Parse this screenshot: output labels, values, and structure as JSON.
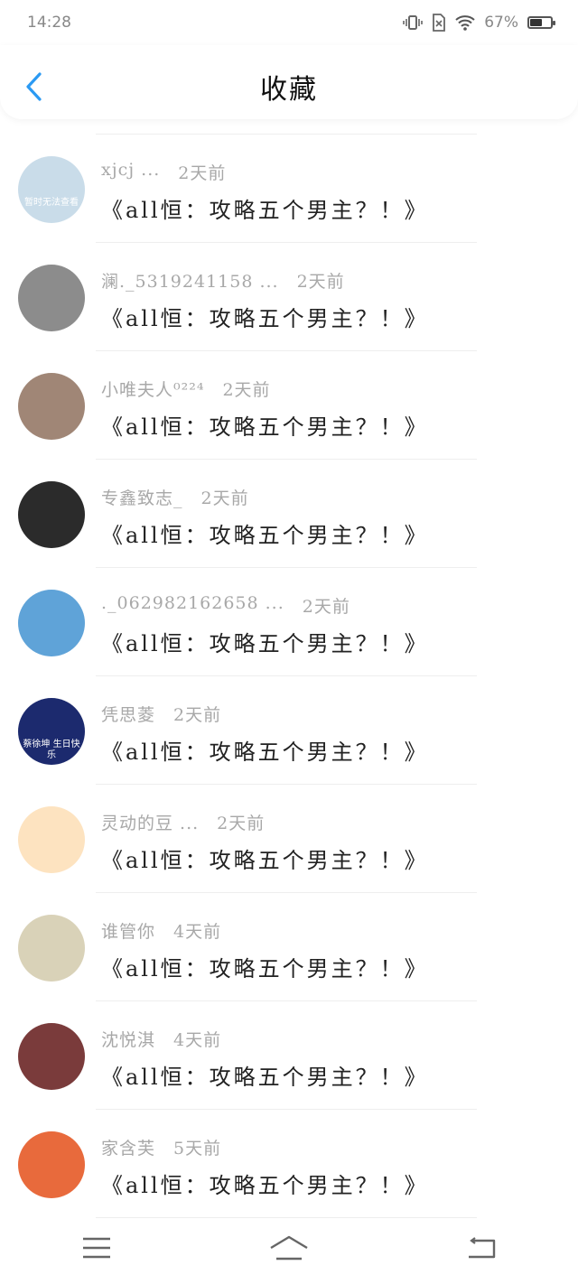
{
  "status_bar": {
    "time": "14:28",
    "battery_percent": "67%",
    "battery_level": 0.67
  },
  "header": {
    "title": "收藏",
    "back_icon": "chevron-left-icon"
  },
  "accent_color": "#2b9af3",
  "items": [
    {
      "user": "xjcj ...",
      "time": "2天前",
      "title": "《all恒：攻略五个男主？！》",
      "avatar_color": "#c9dce9",
      "avatar_text": "暂时无法查看"
    },
    {
      "user": "澜._5319241158 ...",
      "time": "2天前",
      "title": "《all恒：攻略五个男主？！》",
      "avatar_color": "#8c8c8c",
      "avatar_text": ""
    },
    {
      "user": "小唯夫人⁰²²⁴",
      "time": "2天前",
      "title": "《all恒：攻略五个男主？！》",
      "avatar_color": "#a08676",
      "avatar_text": ""
    },
    {
      "user": "专鑫致志_",
      "time": "2天前",
      "title": "《all恒：攻略五个男主？！》",
      "avatar_color": "#2b2b2b",
      "avatar_text": ""
    },
    {
      "user": "._062982162658 ...",
      "time": "2天前",
      "title": "《all恒：攻略五个男主？！》",
      "avatar_color": "#5fa3d8",
      "avatar_text": ""
    },
    {
      "user": "凭思菱",
      "time": "2天前",
      "title": "《all恒：攻略五个男主？！》",
      "avatar_color": "#1c2a6e",
      "avatar_text": "蔡徐坤 生日快乐"
    },
    {
      "user": "灵动的豆 ...",
      "time": "2天前",
      "title": "《all恒：攻略五个男主？！》",
      "avatar_color": "#fde3c0",
      "avatar_text": ""
    },
    {
      "user": "谁管你",
      "time": "4天前",
      "title": "《all恒：攻略五个男主？！》",
      "avatar_color": "#d9d2b8",
      "avatar_text": ""
    },
    {
      "user": "沈悦淇",
      "time": "4天前",
      "title": "《all恒：攻略五个男主？！》",
      "avatar_color": "#7a3b3b",
      "avatar_text": ""
    },
    {
      "user": "家含芙",
      "time": "5天前",
      "title": "《all恒：攻略五个男主？！》",
      "avatar_color": "#e86a3c",
      "avatar_text": ""
    }
  ],
  "nav": {
    "menu_icon": "menu-icon",
    "home_icon": "home-icon",
    "back_icon": "back-icon"
  }
}
